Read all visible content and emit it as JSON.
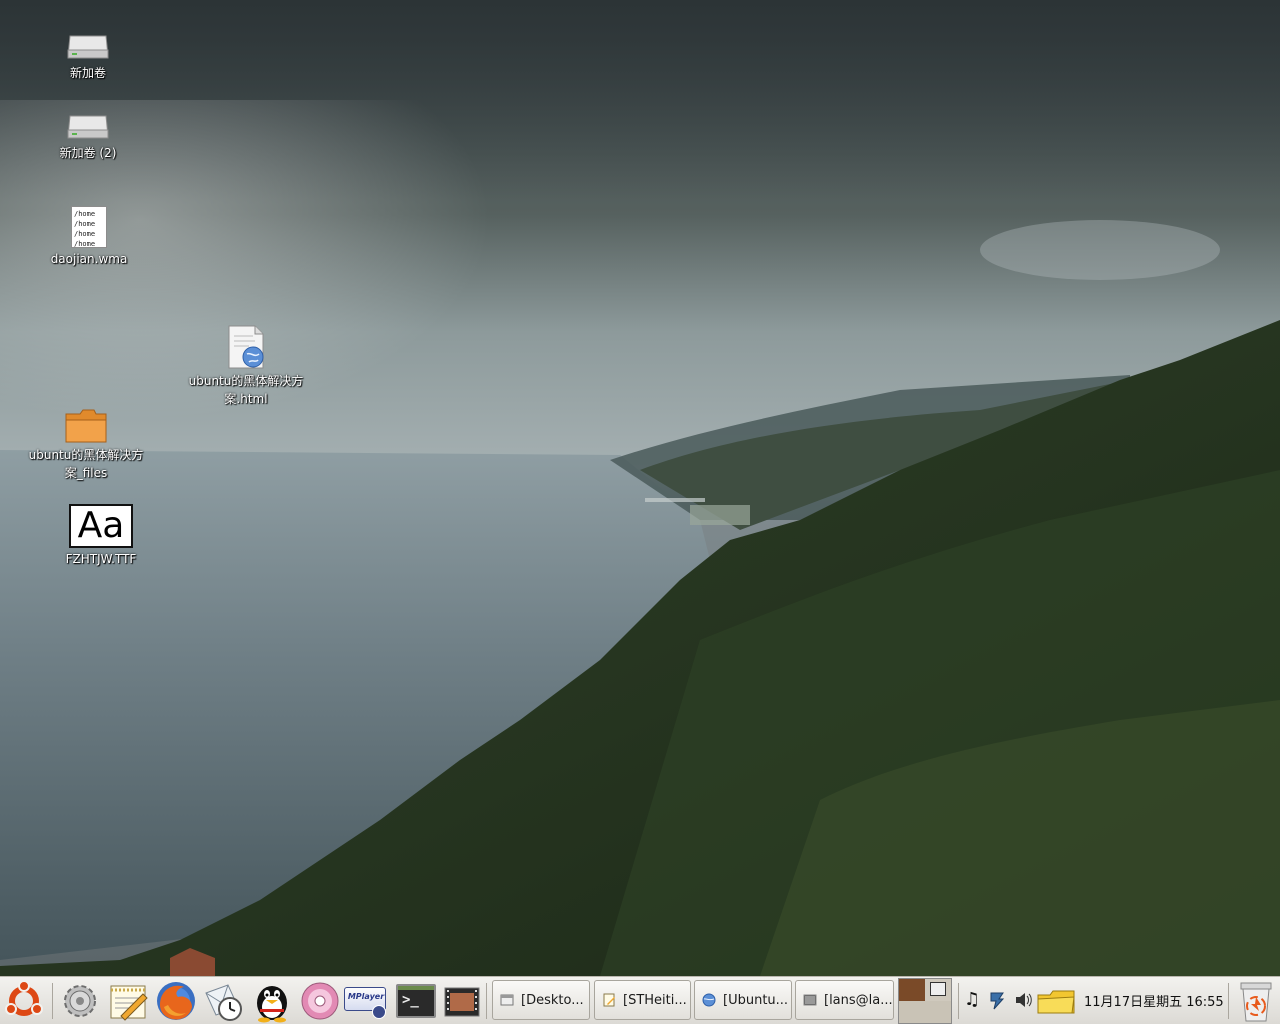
{
  "desktop": {
    "icons": [
      {
        "label": "新加卷",
        "icon": "drive-icon"
      },
      {
        "label": "新加卷 (2)",
        "icon": "drive-icon"
      },
      {
        "label": "daojian.wma",
        "icon": "text-file-icon",
        "preview_lines": [
          "/home",
          "/home",
          "/home",
          "/home"
        ]
      },
      {
        "label": "ubuntu的黑体解决方\n案.html",
        "icon": "html-file-icon"
      },
      {
        "label": "ubuntu的黑体解决方\n案_files",
        "icon": "folder-icon"
      },
      {
        "label": "FZHTJW.TTF",
        "icon": "font-file-icon",
        "preview": "Aa"
      }
    ]
  },
  "panel": {
    "launchers": [
      {
        "name": "ubuntu-menu-icon"
      },
      {
        "name": "system-settings-icon"
      },
      {
        "name": "text-editor-icon"
      },
      {
        "name": "firefox-icon"
      },
      {
        "name": "mail-clock-icon"
      },
      {
        "name": "qq-penguin-icon"
      },
      {
        "name": "cd-player-icon"
      },
      {
        "name": "mplayer-icon",
        "text": "MPlayer"
      },
      {
        "name": "terminal-icon",
        "text": ">_"
      },
      {
        "name": "film-strip-icon"
      }
    ],
    "tasks": [
      {
        "label": "[Deskto...",
        "icon": "window-icon"
      },
      {
        "label": "[STHeiti...",
        "icon": "notepad-icon"
      },
      {
        "label": "[Ubuntu...",
        "icon": "globe-icon"
      },
      {
        "label": "[lans@la...",
        "icon": "terminal-small-icon"
      }
    ],
    "tray": {
      "icons": [
        "music-note-icon",
        "network-icon",
        "volume-icon",
        "mail-folder-icon"
      ],
      "clock": "11月17日星期五 16:55"
    },
    "trash": {
      "name": "trash-icon"
    }
  },
  "colors": {
    "panel_bg": "#e8e6e1",
    "workspace_active": "#7a4a28",
    "workspace_inactive": "#c9c3b6",
    "ubuntu_orange": "#dd4814",
    "folder_orange": "#f2a24a"
  }
}
